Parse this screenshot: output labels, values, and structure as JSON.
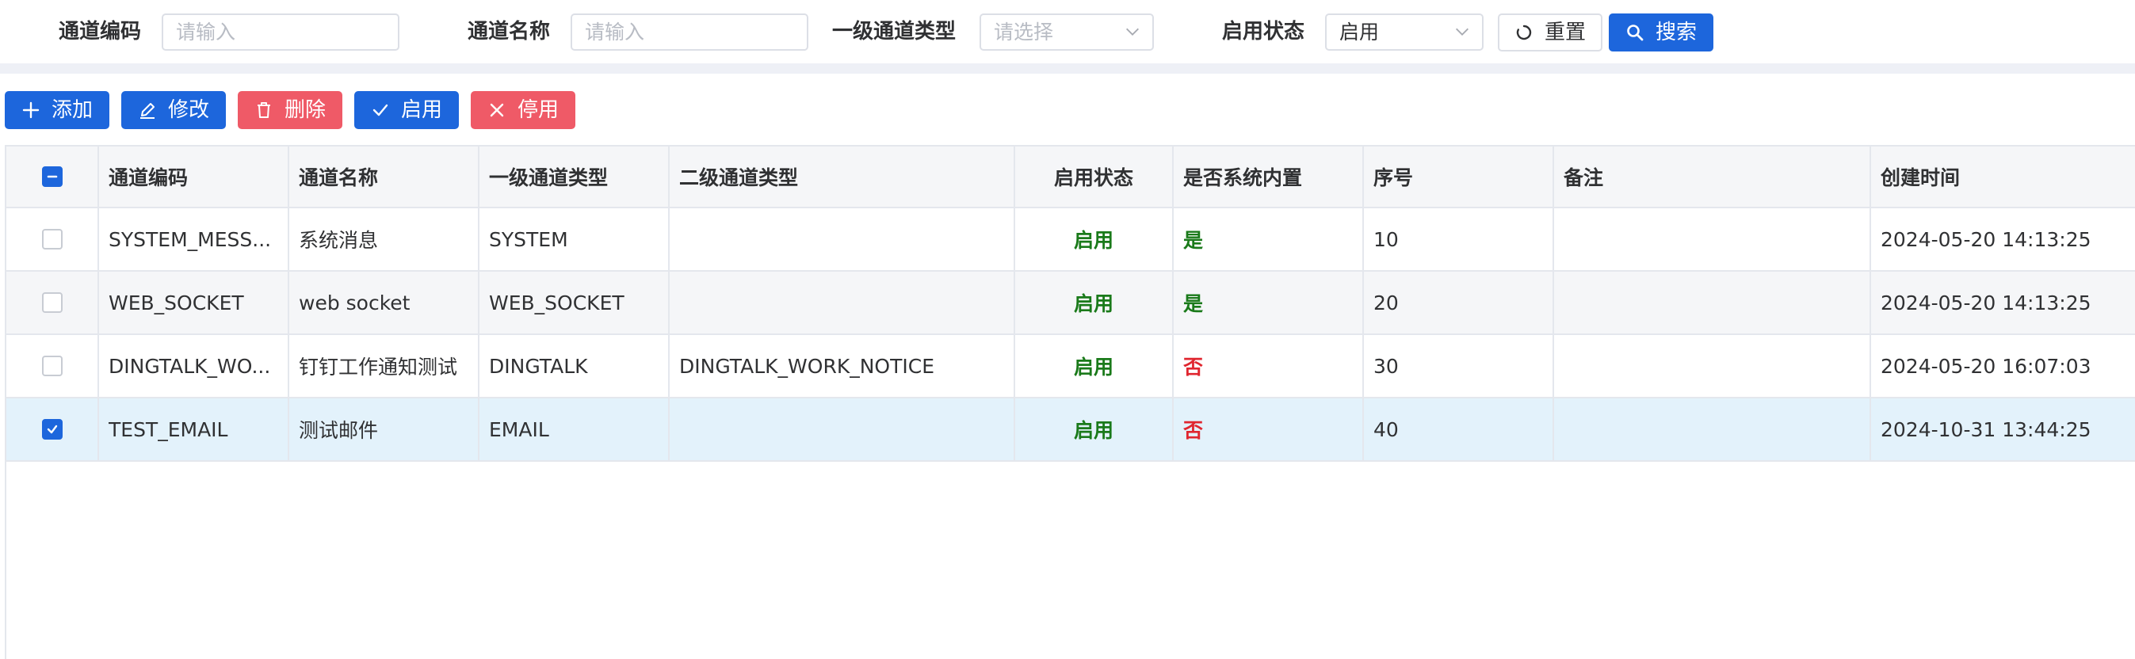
{
  "search": {
    "channel_code_label": "通道编码",
    "channel_code_placeholder": "请输入",
    "channel_name_label": "通道名称",
    "channel_name_placeholder": "请输入",
    "type1_label": "一级通道类型",
    "type1_placeholder": "请选择",
    "status_label": "启用状态",
    "status_value": "启用",
    "reset_label": "重置",
    "search_label": "搜索"
  },
  "toolbar": {
    "add_label": "添加",
    "edit_label": "修改",
    "delete_label": "删除",
    "enable_label": "启用",
    "disable_label": "停用"
  },
  "table": {
    "columns": [
      "通道编码",
      "通道名称",
      "一级通道类型",
      "二级通道类型",
      "启用状态",
      "是否系统内置",
      "序号",
      "备注",
      "创建时间"
    ],
    "rows": [
      {
        "selected": false,
        "code": "SYSTEM_MESS...",
        "name": "系统消息",
        "type1": "SYSTEM",
        "type2": "",
        "status": "启用",
        "builtin": "是",
        "sort": "10",
        "remark": "",
        "created": "2024-05-20 14:13:25"
      },
      {
        "selected": false,
        "code": "WEB_SOCKET",
        "name": "web socket",
        "type1": "WEB_SOCKET",
        "type2": "",
        "status": "启用",
        "builtin": "是",
        "sort": "20",
        "remark": "",
        "created": "2024-05-20 14:13:25"
      },
      {
        "selected": false,
        "code": "DINGTALK_WO...",
        "name": "钉钉工作通知测试",
        "type1": "DINGTALK",
        "type2": "DINGTALK_WORK_NOTICE",
        "status": "启用",
        "builtin": "否",
        "sort": "30",
        "remark": "",
        "created": "2024-05-20 16:07:03"
      },
      {
        "selected": true,
        "code": "TEST_EMAIL",
        "name": "测试邮件",
        "type1": "EMAIL",
        "type2": "",
        "status": "启用",
        "builtin": "否",
        "sort": "40",
        "remark": "",
        "created": "2024-10-31 13:44:25"
      }
    ]
  },
  "colors": {
    "primary": "#1d66dc",
    "danger": "#ef5a67",
    "success_text": "#1a7a1a",
    "error_text": "#e0262f",
    "selected_row": "#e3f2fb",
    "hover_row": "#f5f6f8"
  },
  "icons": {
    "add": "plus-icon",
    "edit": "pencil-icon",
    "delete": "trash-icon",
    "enable": "check-icon",
    "disable": "close-icon",
    "reset": "refresh-icon",
    "search": "search-icon"
  }
}
